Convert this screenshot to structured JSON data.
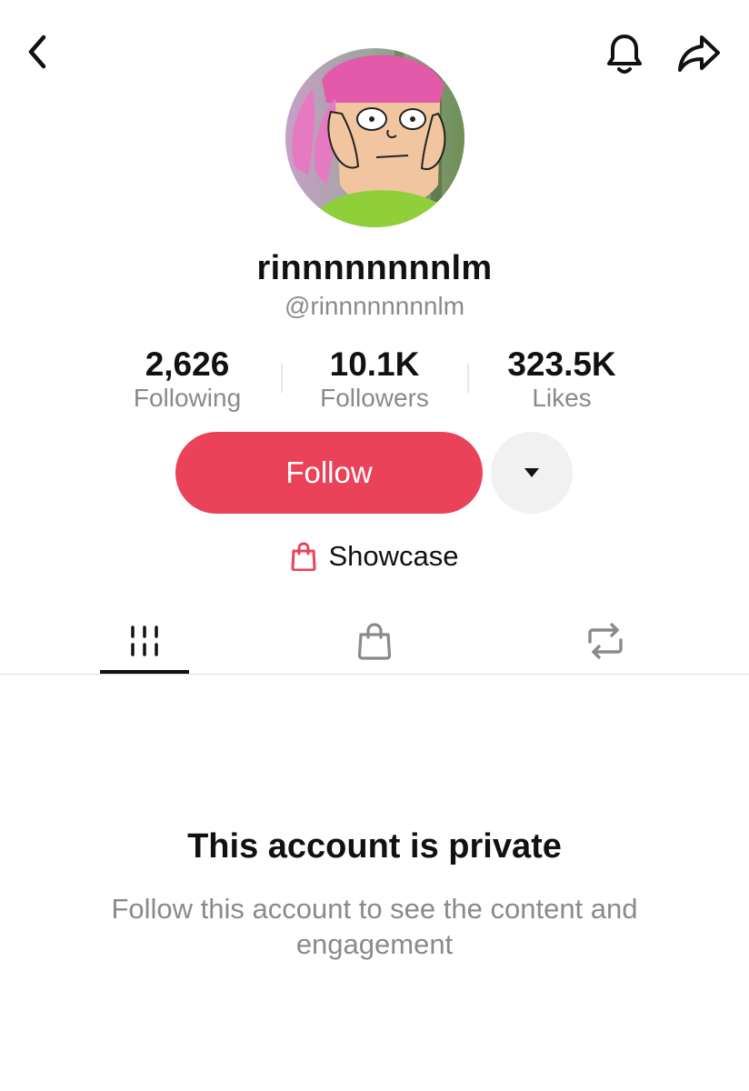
{
  "header": {
    "back_icon": "chevron-left-icon",
    "notification_icon": "bell-icon",
    "share_icon": "share-arrow-icon"
  },
  "profile": {
    "avatar": "cartoon-girl-pink-bunny-ears-avatar",
    "display_name": "rinnnnnnnnlm",
    "handle": "@rinnnnnnnnlm"
  },
  "stats": [
    {
      "value": "2,626",
      "label": "Following"
    },
    {
      "value": "10.1K",
      "label": "Followers"
    },
    {
      "value": "323.5K",
      "label": "Likes"
    }
  ],
  "actions": {
    "follow_label": "Follow",
    "more_icon": "caret-down-icon",
    "accent_color": "#ea4359"
  },
  "showcase": {
    "icon": "shopping-bag-icon",
    "label": "Showcase"
  },
  "tabs": [
    {
      "icon": "grid-icon",
      "active": true
    },
    {
      "icon": "shopping-bag-icon",
      "active": false
    },
    {
      "icon": "repost-icon",
      "active": false
    }
  ],
  "private_notice": {
    "title": "This account is private",
    "subtitle": "Follow this account to see the content and engagement"
  }
}
